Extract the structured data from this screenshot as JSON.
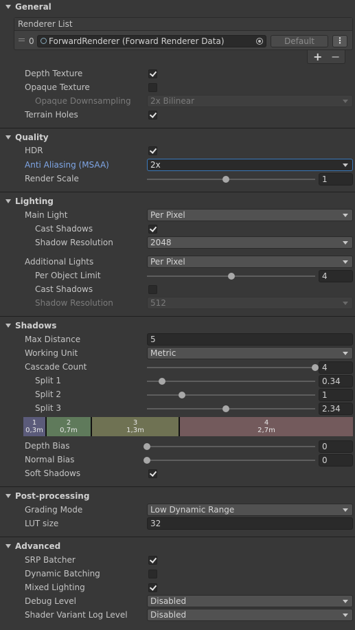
{
  "sections": {
    "general": "General",
    "quality": "Quality",
    "lighting": "Lighting",
    "shadows": "Shadows",
    "postprocessing": "Post-processing",
    "advanced": "Advanced"
  },
  "general": {
    "renderer_list_title": "Renderer List",
    "renderer_index": "0",
    "renderer_value": "ForwardRenderer (Forward Renderer Data)",
    "default_button": "Default",
    "depth_texture": {
      "label": "Depth Texture",
      "checked": true
    },
    "opaque_texture": {
      "label": "Opaque Texture",
      "checked": false
    },
    "opaque_downsampling": {
      "label": "Opaque Downsampling",
      "value": "2x Bilinear"
    },
    "terrain_holes": {
      "label": "Terrain Holes",
      "checked": true
    }
  },
  "quality": {
    "hdr": {
      "label": "HDR",
      "checked": true
    },
    "anti_aliasing": {
      "label": "Anti Aliasing (MSAA)",
      "value": "2x"
    },
    "render_scale": {
      "label": "Render Scale",
      "value": "1",
      "fraction": 0.47
    }
  },
  "lighting": {
    "main_light": {
      "label": "Main Light",
      "value": "Per Pixel"
    },
    "main_cast_shadows": {
      "label": "Cast Shadows",
      "checked": true
    },
    "main_shadow_resolution": {
      "label": "Shadow Resolution",
      "value": "2048"
    },
    "additional_lights": {
      "label": "Additional Lights",
      "value": "Per Pixel"
    },
    "per_object_limit": {
      "label": "Per Object Limit",
      "value": "4",
      "fraction": 0.5
    },
    "add_cast_shadows": {
      "label": "Cast Shadows",
      "checked": false
    },
    "add_shadow_resolution": {
      "label": "Shadow Resolution",
      "value": "512"
    }
  },
  "shadows": {
    "max_distance": {
      "label": "Max Distance",
      "value": "5"
    },
    "working_unit": {
      "label": "Working Unit",
      "value": "Metric"
    },
    "cascade_count": {
      "label": "Cascade Count",
      "value": "4",
      "fraction": 1.0
    },
    "split1": {
      "label": "Split 1",
      "value": "0.34",
      "fraction": 0.09
    },
    "split2": {
      "label": "Split 2",
      "value": "1",
      "fraction": 0.21
    },
    "split3": {
      "label": "Split 3",
      "value": "2.34",
      "fraction": 0.47
    },
    "cascades": [
      {
        "index": "1",
        "distance": "0,3m",
        "color": "#5b5b7a"
      },
      {
        "index": "2",
        "distance": "0,7m",
        "color": "#5f7a5b"
      },
      {
        "index": "3",
        "distance": "1,3m",
        "color": "#6f7253"
      },
      {
        "index": "4",
        "distance": "2,7m",
        "color": "#735a5c"
      }
    ],
    "depth_bias": {
      "label": "Depth Bias",
      "value": "0",
      "fraction": 0.0
    },
    "normal_bias": {
      "label": "Normal Bias",
      "value": "0",
      "fraction": 0.0
    },
    "soft_shadows": {
      "label": "Soft Shadows",
      "checked": true
    }
  },
  "postprocessing": {
    "grading_mode": {
      "label": "Grading Mode",
      "value": "Low Dynamic Range"
    },
    "lut_size": {
      "label": "LUT size",
      "value": "32"
    }
  },
  "advanced": {
    "srp_batcher": {
      "label": "SRP Batcher",
      "checked": true
    },
    "dynamic_batching": {
      "label": "Dynamic Batching",
      "checked": false
    },
    "mixed_lighting": {
      "label": "Mixed Lighting",
      "checked": true
    },
    "debug_level": {
      "label": "Debug Level",
      "value": "Disabled"
    },
    "shader_variant_log": {
      "label": "Shader Variant Log Level",
      "value": "Disabled"
    }
  },
  "colors": {
    "accent": "#3a79bb",
    "label_highlight": "#7fa6e6"
  }
}
